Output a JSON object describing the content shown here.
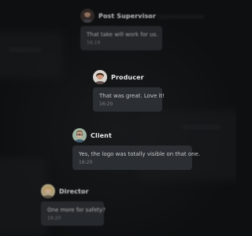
{
  "thread": {
    "messages": [
      {
        "author": "Post Supervisor",
        "text": "That take will work for us.",
        "time": "16:19",
        "avatar_icon": "avatar-post-supervisor-icon"
      },
      {
        "author": "Producer",
        "text": "That was great.  Love it!",
        "time": "16:20",
        "avatar_icon": "avatar-producer-icon"
      },
      {
        "author": "Client",
        "text": "Yes, the logo was totally visible on that one.",
        "time": "16:20",
        "avatar_icon": "avatar-client-icon"
      },
      {
        "author": "Director",
        "text": "One more for safety?",
        "time": "16:20",
        "avatar_icon": "avatar-director-icon"
      }
    ]
  },
  "colors": {
    "background": "#0e0f10",
    "bubble": "#2b2e32",
    "author_text": "#e8e9ea",
    "message_text": "#c8cacc",
    "timestamp_text": "#7e8186"
  }
}
